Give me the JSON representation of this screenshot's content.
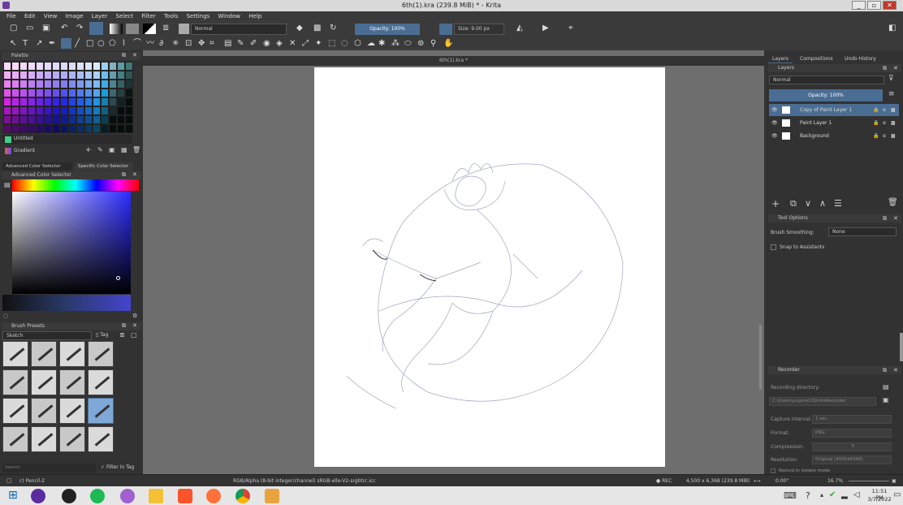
{
  "window": {
    "title": "6th(1).kra (239.8 MiB) * - Krita",
    "min": "_",
    "max": "▫",
    "close": "✕"
  },
  "menu": [
    "File",
    "Edit",
    "View",
    "Image",
    "Layer",
    "Select",
    "Filter",
    "Tools",
    "Settings",
    "Window",
    "Help"
  ],
  "toolbar": {
    "blend_mode": "Normal",
    "opacity": "Opacity: 100%",
    "size": "Size: 9.00 px"
  },
  "document_tab": "6th(1).kra *",
  "left": {
    "palette_title": "Palette",
    "swatch_name": "Untitled",
    "gradient_label": "Gradient",
    "tabs": [
      "Advanced Color Selector",
      "Specific Color Selector"
    ],
    "acs_title": "Advanced Color Selector",
    "brush_presets_title": "Brush Presets",
    "brush_filter": "Sketch",
    "tag_label": "Tag",
    "search_placeholder": "Search",
    "filter_in_tag": "Filter in Tag"
  },
  "right": {
    "tabs": [
      "Layers",
      "Compositions",
      "Undo History"
    ],
    "layers_title": "Layers",
    "blend": "Normal",
    "opacity": "Opacity: 100%",
    "layers": [
      {
        "name": "Copy of Paint Layer 1",
        "selected": true
      },
      {
        "name": "Paint Layer 1",
        "selected": false
      },
      {
        "name": "Background",
        "selected": false
      }
    ],
    "tool_options_title": "Tool Options",
    "brush_smoothing_label": "Brush Smoothing:",
    "brush_smoothing_value": "None",
    "snap_label": "Snap to Assistants",
    "recorder_title": "Recorder",
    "recording_dir_label": "Recording directory:",
    "recording_dir": "C:\\Users\\yugure12\\KritaRecorder",
    "capture_label": "Capture interval:",
    "capture_value": "1 sec",
    "format_label": "Format:",
    "format_value": "PNG",
    "compression_label": "Compression:",
    "compression_value": "5",
    "resolution_label": "Resolution:",
    "resolution_value": "Original (4500x6368)",
    "record_label": "Record in isolate mode"
  },
  "status": {
    "brush": "c) Pencil-2",
    "color_info": "RGB/Alpha (8-bit integer/channel)  sRGB-elle-V2-srgbtrc.icc",
    "rec": "● REC",
    "dimensions": "4,500 x 6,368 (239.8 MiB)",
    "rotation": "0.00°",
    "zoom": "16.7%"
  },
  "clock": {
    "time": "11:51 PM",
    "date": "3/7/2022"
  }
}
